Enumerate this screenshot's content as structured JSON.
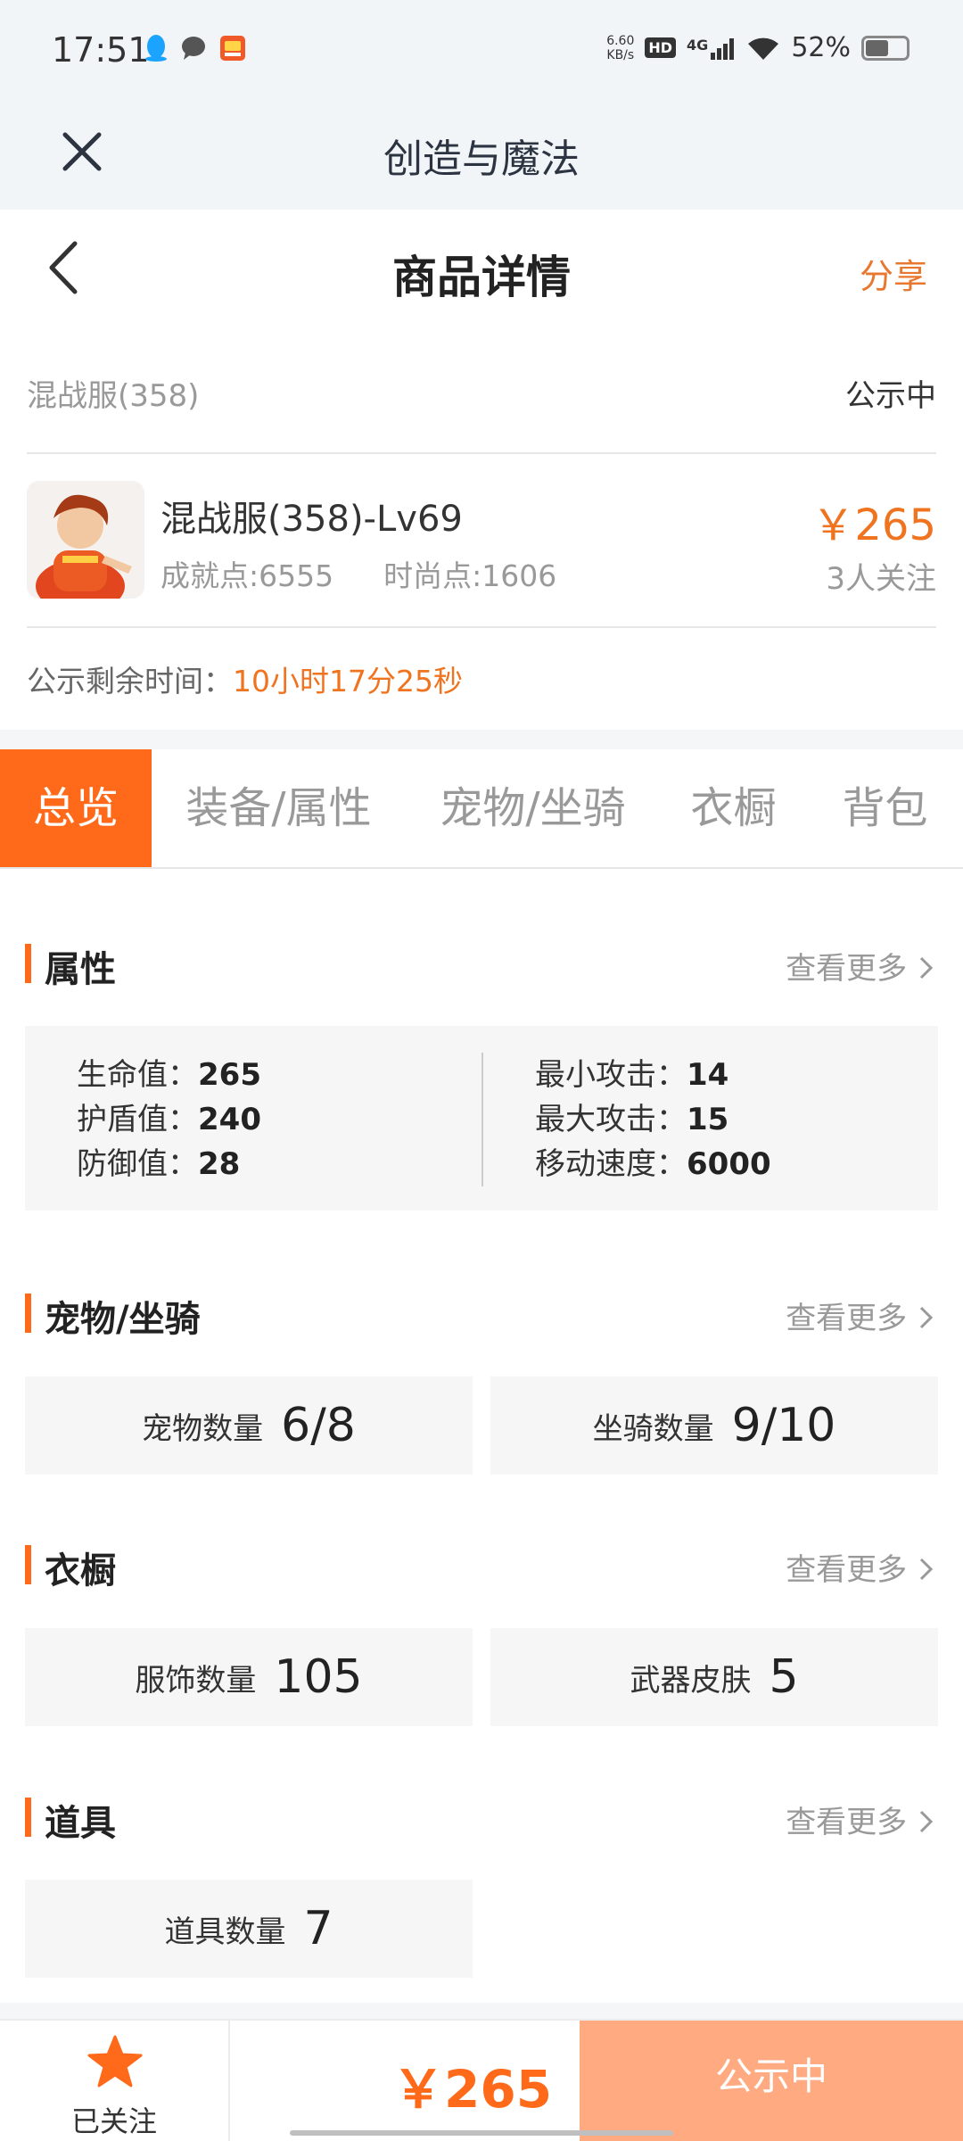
{
  "status_bar": {
    "time": "17:51",
    "net_speed_value": "6.60",
    "net_speed_unit": "KB/s",
    "hd": "HD",
    "network": "4G",
    "battery": "52%",
    "battery_level": 0.52,
    "icons": [
      "qq-icon",
      "chat-bubble-icon",
      "app-notification-icon",
      "signal-icon",
      "wifi-icon",
      "battery-icon"
    ]
  },
  "app_header": {
    "title": "创造与魔法",
    "close_icon": "close-icon"
  },
  "page_header": {
    "title": "商品详情",
    "share": "分享",
    "back_icon": "chevron-left-icon"
  },
  "listing": {
    "server": "混战服(358)",
    "status": "公示中",
    "name": "混战服(358)-Lv69",
    "achievement": "成就点:6555",
    "fashion": "时尚点:1606",
    "price": "￥265",
    "followers": "3人关注",
    "countdown_label": "公示剩余时间：",
    "countdown_value": "10小时17分25秒"
  },
  "tabs": [
    {
      "label": "总览",
      "active": true
    },
    {
      "label": "装备/属性",
      "active": false
    },
    {
      "label": "宠物/坐骑",
      "active": false
    },
    {
      "label": "衣橱",
      "active": false
    },
    {
      "label": "背包",
      "active": false
    }
  ],
  "more_label": "查看更多",
  "sections": {
    "attributes": {
      "title": "属性",
      "left": [
        {
          "label": "生命值：",
          "value": "265"
        },
        {
          "label": "护盾值：",
          "value": "240"
        },
        {
          "label": "防御值：",
          "value": "28"
        }
      ],
      "right": [
        {
          "label": "最小攻击：",
          "value": "14"
        },
        {
          "label": "最大攻击：",
          "value": "15"
        },
        {
          "label": "移动速度：",
          "value": "6000"
        }
      ]
    },
    "pets": {
      "title": "宠物/坐骑",
      "cards": [
        {
          "label": "宠物数量",
          "value": "6/8"
        },
        {
          "label": "坐骑数量",
          "value": "9/10"
        }
      ]
    },
    "wardrobe": {
      "title": "衣橱",
      "cards": [
        {
          "label": "服饰数量",
          "value": "105"
        },
        {
          "label": "武器皮肤",
          "value": "5"
        }
      ]
    },
    "items": {
      "title": "道具",
      "cards": [
        {
          "label": "道具数量",
          "value": "7"
        }
      ]
    }
  },
  "bottom_bar": {
    "follow_label": "已关注",
    "price": "￥265",
    "status_button": "公示中"
  },
  "colors": {
    "accent": "#ff6a1a",
    "price": "#f07420",
    "status_button": "#ffaa80",
    "header_bg": "#f2f5f8"
  }
}
